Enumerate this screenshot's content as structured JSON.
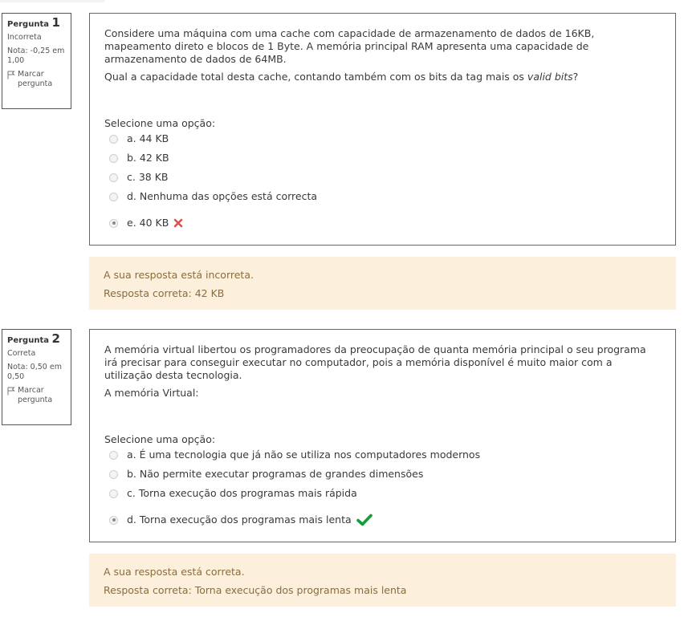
{
  "questions": [
    {
      "label": "Pergunta",
      "number": "1",
      "state": "Incorreta",
      "grade": "Nota: -0,25 em 1,00",
      "flag_label": "Marcar pergunta",
      "text1": "Considere uma máquina com uma cache com capacidade de armazenamento de dados de 16KB, mapeamento direto e blocos de 1 Byte. A memória principal RAM apresenta uma capacidade de armazenamento de dados de 64MB.",
      "text2_before": "Qual a capacidade total desta cache, contando também com os bits da tag mais os ",
      "text2_em": "valid bits",
      "text2_after": "?",
      "prompt": "Selecione uma opção:",
      "options": [
        {
          "label": "a. 44 KB"
        },
        {
          "label": "b. 42 KB"
        },
        {
          "label": "c. 38 KB"
        },
        {
          "label": "d. Nenhuma das opções está correcta"
        },
        {
          "label": "e. 40 KB",
          "selected": true,
          "mark": "cross-icon",
          "mark_color": "#d9534f"
        }
      ],
      "feedback_status": "A sua resposta está incorreta.",
      "feedback_answer": "Resposta correta: 42 KB"
    },
    {
      "label": "Pergunta",
      "number": "2",
      "state": "Correta",
      "grade": "Nota: 0,50 em 0,50",
      "flag_label": "Marcar pergunta",
      "text1": "A memória virtual libertou os programadores da preocupação de quanta memória principal o seu programa irá precisar para conseguir executar no computador, pois a memória disponível é muito maior com a utilização desta tecnologia.",
      "text2": "A memória Virtual:",
      "prompt": "Selecione uma opção:",
      "options": [
        {
          "label": "a. É uma tecnologia que já não se utiliza nos computadores modernos"
        },
        {
          "label": "b. Não permite executar programas de grandes dimensões"
        },
        {
          "label": "c. Torna execução dos programas mais rápida"
        },
        {
          "label": "d. Torna execução dos programas mais lenta",
          "selected": true,
          "mark": "check-icon",
          "mark_color": "#1a9b3b"
        }
      ],
      "feedback_status": "A sua resposta está correta.",
      "feedback_answer": "Resposta correta: Torna execução dos programas mais lenta"
    }
  ]
}
